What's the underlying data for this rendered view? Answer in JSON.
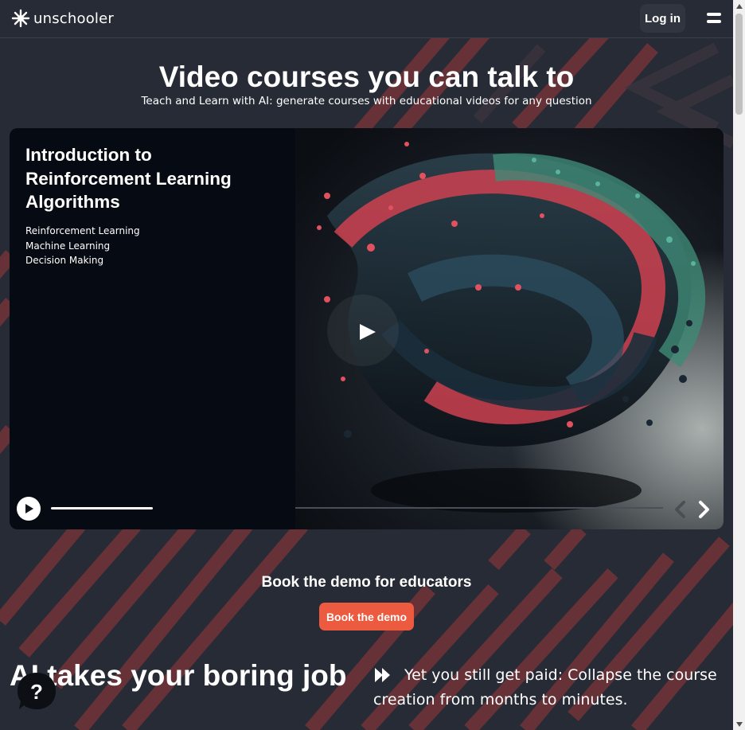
{
  "header": {
    "logo_text": "unschooler",
    "logo_icon": "starburst-icon",
    "login_label": "Log in",
    "menu_icon": "hamburger-menu-icon"
  },
  "hero": {
    "title": "Video courses you can talk to",
    "subtitle": "Teach and Learn with AI: generate courses with educational videos for any question"
  },
  "video_card": {
    "course_title": "Introduction to Reinforcement Learning Algorithms",
    "topics": [
      "Reinforcement Learning",
      "Machine Learning",
      "Decision Making"
    ],
    "progress_fraction": 0.3
  },
  "demo": {
    "heading": "Book the demo for educators",
    "button_label": "Book the demo"
  },
  "ai_section": {
    "heading": "AI takes your boring job",
    "description": "Yet you still get paid: Collapse the course creation from months to minutes."
  },
  "help": {
    "label": "?"
  },
  "colors": {
    "background": "#262b35",
    "accent": "#ec5a3f",
    "stripe": "#8e3a3d",
    "card": "#060a12"
  }
}
